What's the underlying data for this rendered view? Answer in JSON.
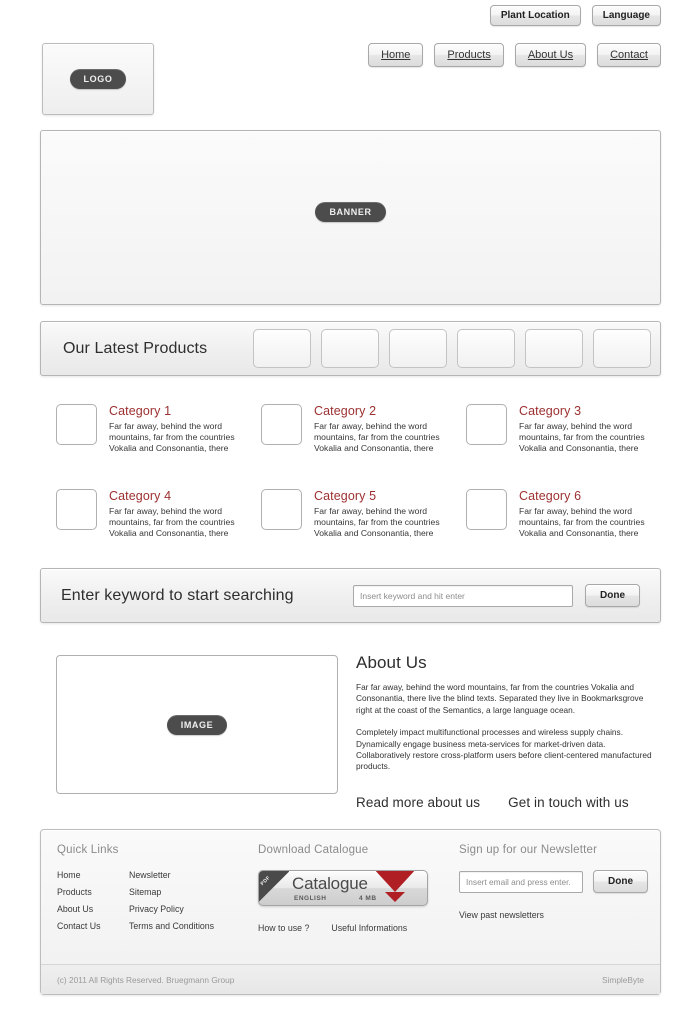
{
  "utility": {
    "plant_location": "Plant Location",
    "language": "Language"
  },
  "header": {
    "logo_label": "LOGO",
    "nav": [
      {
        "label": "Home"
      },
      {
        "label": "Products"
      },
      {
        "label": "About Us"
      },
      {
        "label": "Contact"
      }
    ]
  },
  "banner": {
    "label": "BANNER"
  },
  "latest_products": {
    "title": "Our Latest Products",
    "thumbnails": [
      {
        "name": "product-thumb-1"
      },
      {
        "name": "product-thumb-2"
      },
      {
        "name": "product-thumb-3"
      },
      {
        "name": "product-thumb-4"
      },
      {
        "name": "product-thumb-5"
      },
      {
        "name": "product-thumb-6"
      }
    ]
  },
  "categories": [
    {
      "title": "Category 1",
      "desc": "Far far away, behind the word mountains, far from the countries Vokalia and Consonantia, there"
    },
    {
      "title": "Category 2",
      "desc": "Far far away, behind the word mountains, far from the countries Vokalia and Consonantia, there"
    },
    {
      "title": "Category 3",
      "desc": "Far far away, behind the word mountains, far from the countries Vokalia and Consonantia, there"
    },
    {
      "title": "Category 4",
      "desc": "Far far away, behind the word mountains, far from the countries Vokalia and Consonantia, there"
    },
    {
      "title": "Category 5",
      "desc": "Far far away, behind the word mountains, far from the countries Vokalia and Consonantia, there"
    },
    {
      "title": "Category 6",
      "desc": "Far far away, behind the word mountains, far from the countries Vokalia and Consonantia, there"
    }
  ],
  "search": {
    "label": "Enter keyword to start searching",
    "placeholder": "Insert keyword and hit enter",
    "value": "",
    "button": "Done"
  },
  "about": {
    "image_label": "IMAGE",
    "heading": "About Us",
    "paragraph1": "Far far away, behind the word mountains, far from the countries Vokalia and Consonantia, there live the blind texts. Separated they live in Bookmarksgrove right at the coast of the Semantics, a large language ocean.",
    "paragraph2": "Completely impact multifunctional processes and wireless supply chains. Dynamically engage business meta-services for market-driven data. Collaboratively restore cross-platform users before client-centered manufactured products.",
    "link_read_more": "Read more about us",
    "link_get_in_touch": "Get in touch with us"
  },
  "footer": {
    "quick_links": {
      "heading": "Quick Links",
      "items": [
        {
          "label": "Home"
        },
        {
          "label": "Newsletter"
        },
        {
          "label": "Products"
        },
        {
          "label": "Sitemap"
        },
        {
          "label": "About Us"
        },
        {
          "label": "Privacy Policy"
        },
        {
          "label": "Contact Us"
        },
        {
          "label": "Terms and Conditions"
        }
      ]
    },
    "catalogue": {
      "heading": "Download Catalogue",
      "ribbon": "PDF",
      "name": "Catalogue",
      "language": "ENGLISH",
      "size": "4 MB",
      "sub_links": [
        {
          "label": "How to use ?"
        },
        {
          "label": "Useful Informations"
        }
      ]
    },
    "newsletter": {
      "heading": "Sign up for our Newsletter",
      "placeholder": "Insert email and press enter.",
      "value": "",
      "button": "Done",
      "sub_link": "View past newsletters"
    },
    "copyright_left": "(c) 2011 All Rights Reserved. Bruegmann Group",
    "copyright_right": "SimpleByte"
  },
  "colors": {
    "category_heading": "#9c3030",
    "download_arrow": "#b01f24",
    "pill_bg": "#4c4c4c",
    "muted_text": "#8b8b8b"
  }
}
